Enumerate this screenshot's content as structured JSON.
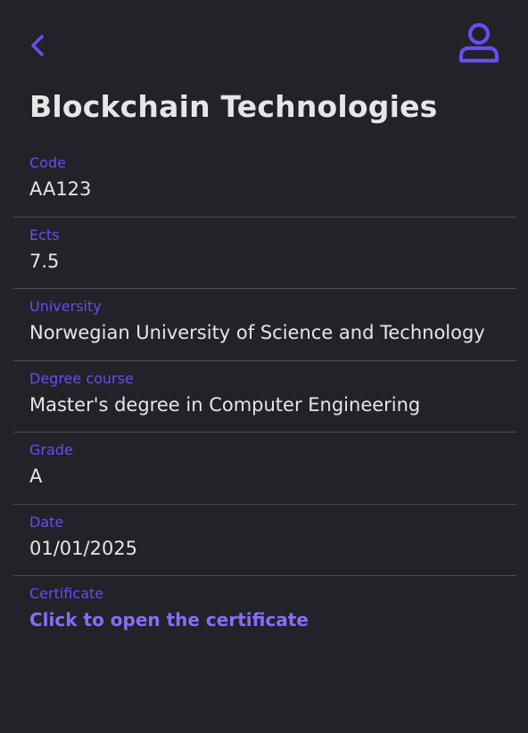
{
  "header": {
    "back_icon": "chevron-left-icon",
    "profile_icon": "user-icon",
    "accent_color": "#6a4cf0"
  },
  "course": {
    "title": "Blockchain Technologies"
  },
  "fields": {
    "code": {
      "label": "Code",
      "value": "AA123"
    },
    "ects": {
      "label": "Ects",
      "value": "7.5"
    },
    "university": {
      "label": "University",
      "value": "Norwegian University of Science and Technology"
    },
    "degree_course": {
      "label": "Degree course",
      "value": "Master's degree in Computer Engineering"
    },
    "grade": {
      "label": "Grade",
      "value": "A"
    },
    "date": {
      "label": "Date",
      "value": "01/01/2025"
    },
    "certificate": {
      "label": "Certificate",
      "link_text": "Click to open the certificate"
    }
  }
}
